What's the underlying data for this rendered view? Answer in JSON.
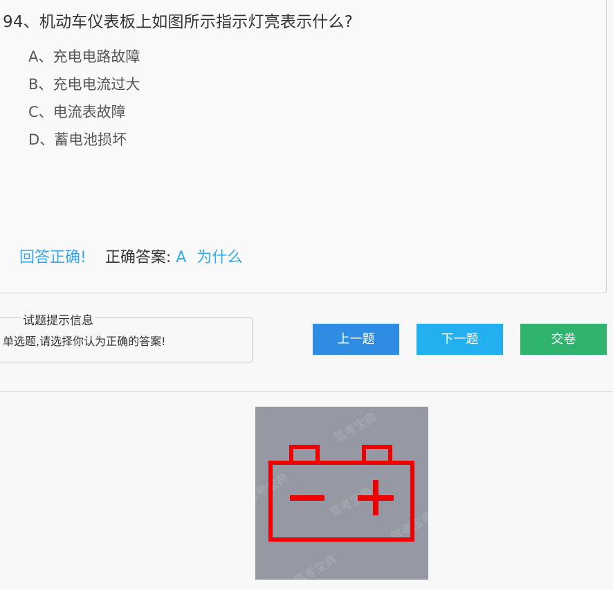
{
  "question": {
    "title": "94、机动车仪表板上如图所示指示灯亮表示什么?",
    "options": [
      "A、充电电路故障",
      "B、充电电流过大",
      "C、电流表故障",
      "D、蓄电池损坏"
    ]
  },
  "result": {
    "status": "回答正确!",
    "answer_label": "正确答案:",
    "answer_value": "A",
    "why_link": "为什么"
  },
  "hint": {
    "legend": "试题提示信息",
    "text": "单选题,请选择你认为正确的答案!"
  },
  "buttons": {
    "prev": "上一题",
    "next": "下一题",
    "submit": "交卷"
  },
  "image": {
    "icon": "battery-warning-icon",
    "watermark": "驾考宝典",
    "background_color": "#9699a3",
    "icon_color": "#ee0000"
  }
}
